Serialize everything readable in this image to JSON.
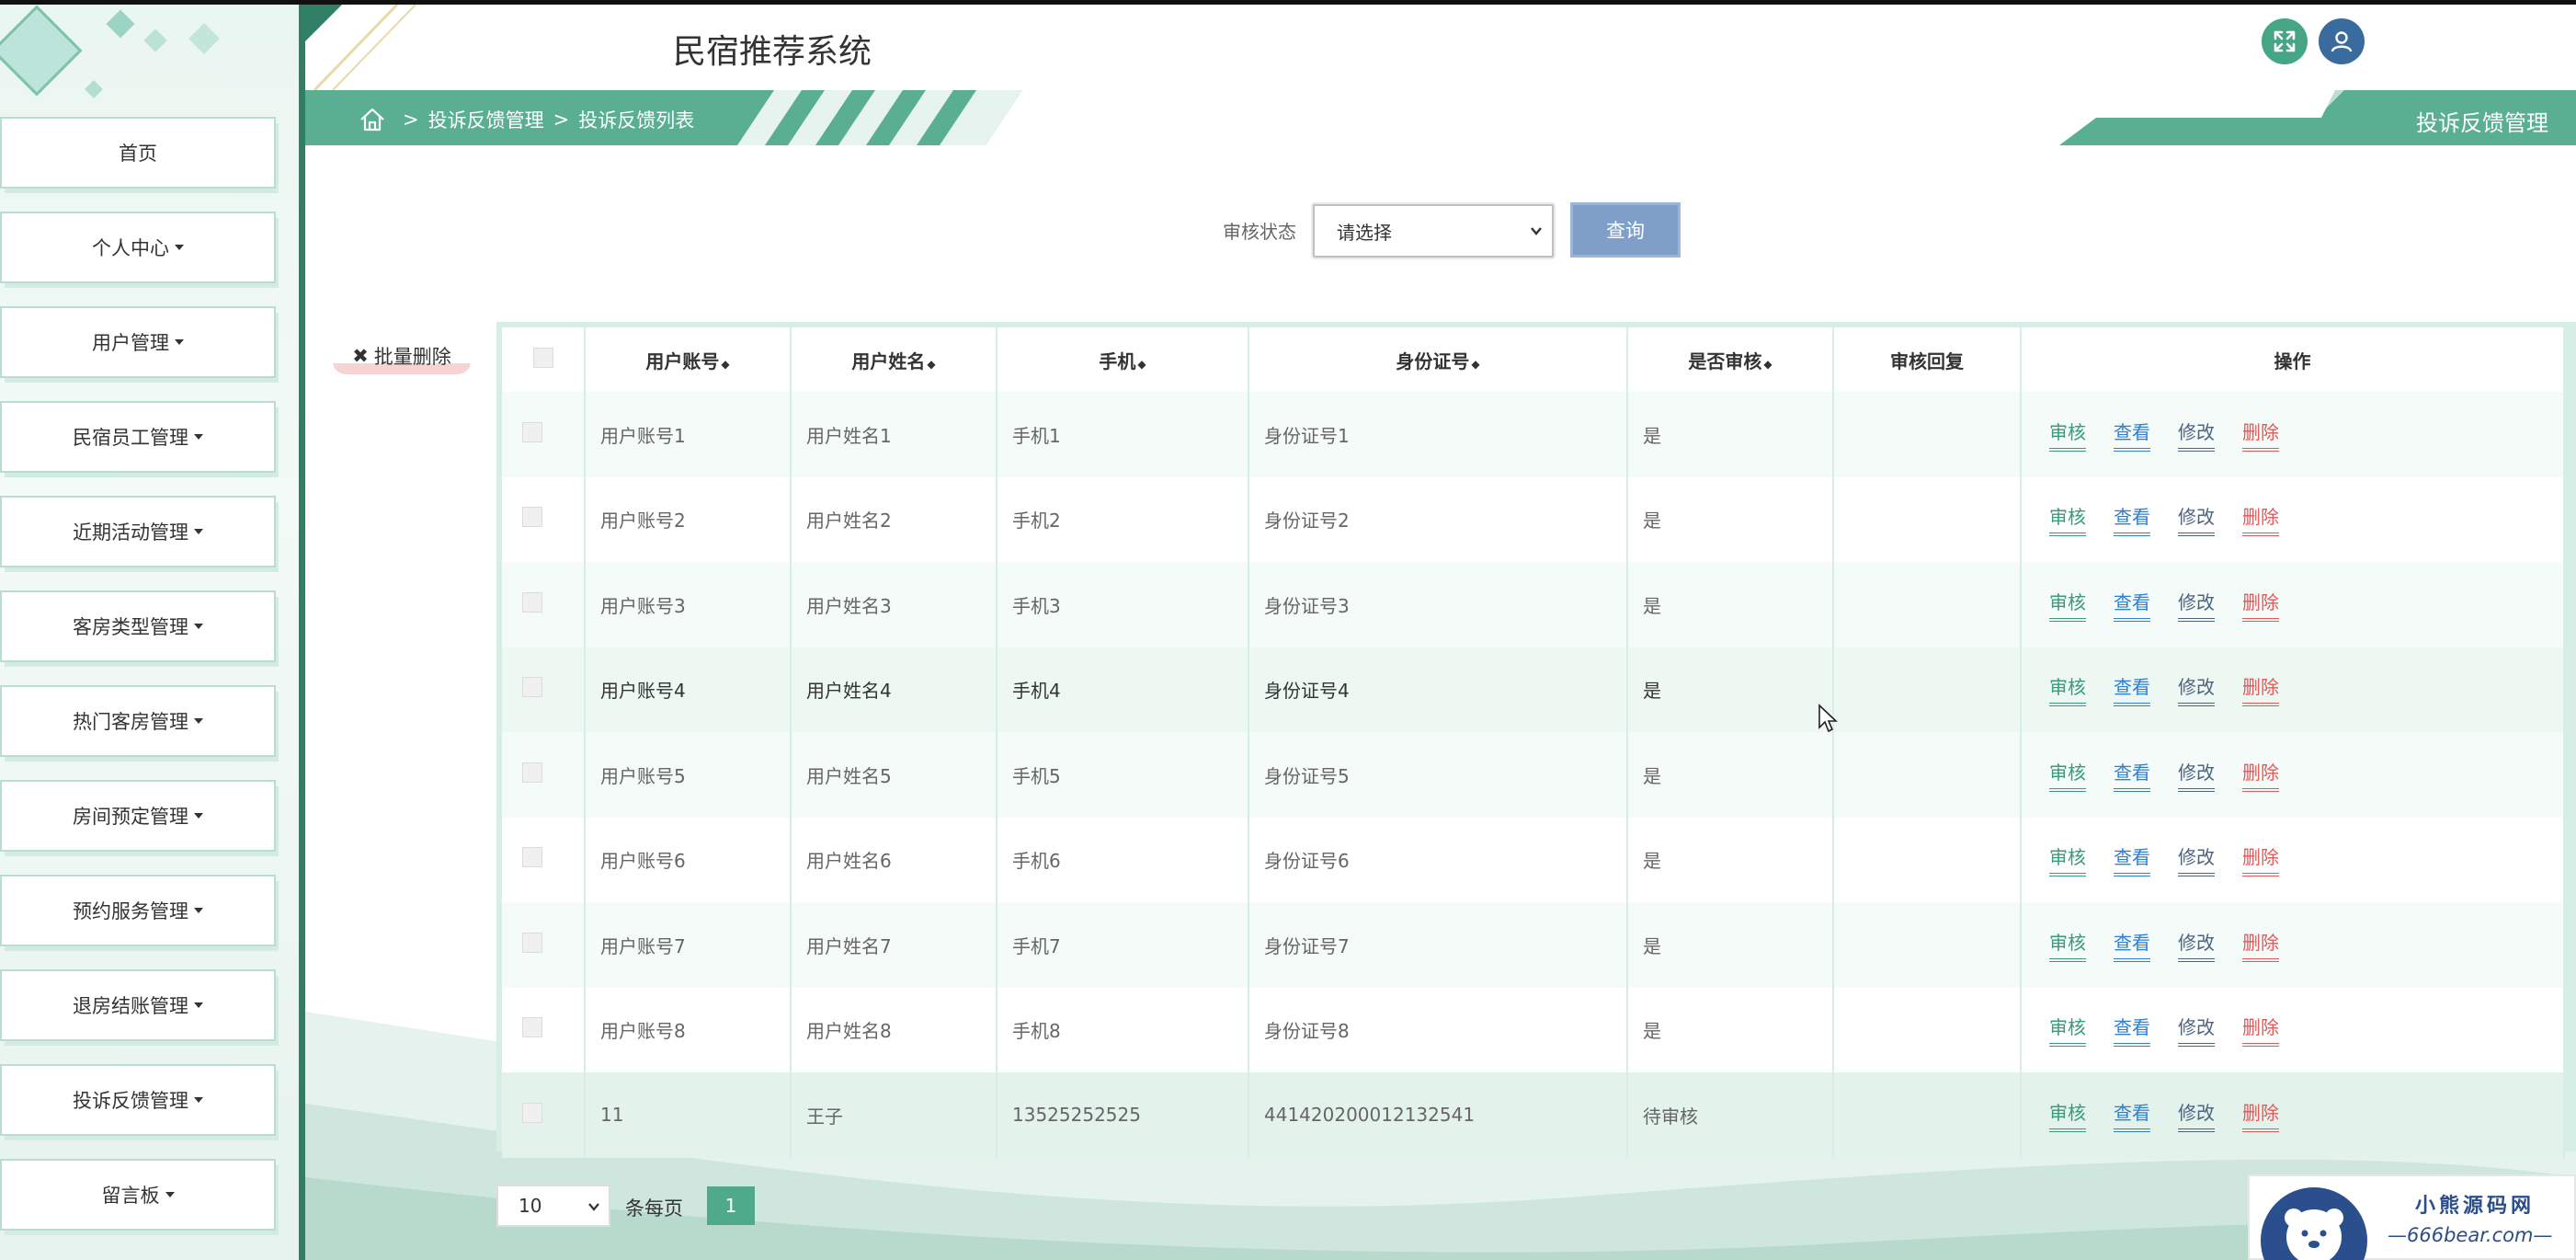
{
  "app": {
    "title": "民宿推荐系统"
  },
  "sidebar": {
    "items": [
      {
        "label": "首页",
        "dropdown": false
      },
      {
        "label": "个人中心",
        "dropdown": true
      },
      {
        "label": "用户管理",
        "dropdown": true
      },
      {
        "label": "民宿员工管理",
        "dropdown": true
      },
      {
        "label": "近期活动管理",
        "dropdown": true
      },
      {
        "label": "客房类型管理",
        "dropdown": true
      },
      {
        "label": "热门客房管理",
        "dropdown": true
      },
      {
        "label": "房间预定管理",
        "dropdown": true
      },
      {
        "label": "预约服务管理",
        "dropdown": true
      },
      {
        "label": "退房结账管理",
        "dropdown": true
      },
      {
        "label": "投诉反馈管理",
        "dropdown": true
      },
      {
        "label": "留言板",
        "dropdown": true
      }
    ]
  },
  "breadcrumb": {
    "separator": ">",
    "level1": "投诉反馈管理",
    "level2": "投诉反馈列表"
  },
  "section_title": "投诉反馈管理",
  "search": {
    "label": "审核状态",
    "select_value": "请选择",
    "button": "查询"
  },
  "batch_delete": "批量删除",
  "table": {
    "headers": [
      "用户账号",
      "用户姓名",
      "手机",
      "身份证号",
      "是否审核",
      "审核回复",
      "操作"
    ],
    "rows": [
      {
        "account": "用户账号1",
        "name": "用户姓名1",
        "phone": "手机1",
        "idcard": "身份证号1",
        "reviewed": "是",
        "reply": ""
      },
      {
        "account": "用户账号2",
        "name": "用户姓名2",
        "phone": "手机2",
        "idcard": "身份证号2",
        "reviewed": "是",
        "reply": ""
      },
      {
        "account": "用户账号3",
        "name": "用户姓名3",
        "phone": "手机3",
        "idcard": "身份证号3",
        "reviewed": "是",
        "reply": ""
      },
      {
        "account": "用户账号4",
        "name": "用户姓名4",
        "phone": "手机4",
        "idcard": "身份证号4",
        "reviewed": "是",
        "reply": ""
      },
      {
        "account": "用户账号5",
        "name": "用户姓名5",
        "phone": "手机5",
        "idcard": "身份证号5",
        "reviewed": "是",
        "reply": ""
      },
      {
        "account": "用户账号6",
        "name": "用户姓名6",
        "phone": "手机6",
        "idcard": "身份证号6",
        "reviewed": "是",
        "reply": ""
      },
      {
        "account": "用户账号7",
        "name": "用户姓名7",
        "phone": "手机7",
        "idcard": "身份证号7",
        "reviewed": "是",
        "reply": ""
      },
      {
        "account": "用户账号8",
        "name": "用户姓名8",
        "phone": "手机8",
        "idcard": "身份证号8",
        "reviewed": "是",
        "reply": ""
      },
      {
        "account": "11",
        "name": "王子",
        "phone": "13525252525",
        "idcard": "441420200012132541",
        "reviewed": "待审核",
        "reply": ""
      }
    ],
    "actions": {
      "audit": "审核",
      "view": "查看",
      "edit": "修改",
      "delete": "删除"
    }
  },
  "pagination": {
    "page_size": "10",
    "per_page_label": "条每页",
    "current_page": "1"
  },
  "watermark": {
    "line1": "小熊源码网",
    "line2": "—666bear.com—"
  },
  "colors": {
    "primary": "#4fa98b",
    "band": "#5aaf92",
    "sidebar_bg": "#eaf6f1",
    "audit": "#3a9a7c",
    "view": "#2f7fd3",
    "edit": "#4d6480",
    "delete": "#e45757",
    "query_button": "#7f9fc9"
  }
}
